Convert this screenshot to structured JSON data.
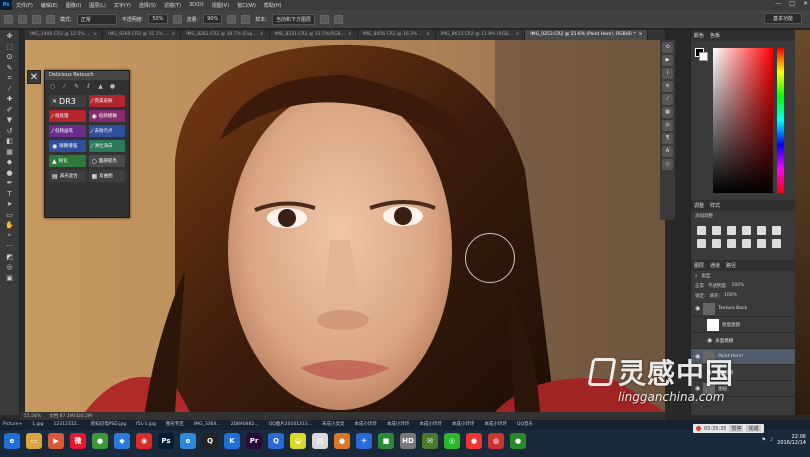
{
  "menubar": {
    "logo": "Ps",
    "items": [
      "文件(F)",
      "编辑(E)",
      "图像(I)",
      "图层(L)",
      "文字(Y)",
      "选择(S)",
      "滤镜(T)",
      "3D(D)",
      "视图(V)",
      "窗口(W)",
      "帮助(H)"
    ],
    "controls": [
      "—",
      "□",
      "✕"
    ]
  },
  "options": {
    "mode_label": "模式:",
    "mode_value": "正常",
    "opacity_label": "不透明度:",
    "opacity_value": "50%",
    "flow_label": "流量:",
    "flow_value": "90%",
    "sample_label": "样本:",
    "sample_value": "当前和下方图层",
    "workspace": "基本功能"
  },
  "tabs": [
    {
      "label": "IMG_1490.CR2 @ 12.5% ..."
    },
    {
      "label": "IMG_8269.CR2 @ 15.1% ..."
    },
    {
      "label": "IMG_8281.CR2 @ 18.7% (Exp..."
    },
    {
      "label": "IMG_8331.CR2 @ 13.5%(RGB..."
    },
    {
      "label": "IMG_8456.CR2 @ 16.3% ..."
    },
    {
      "label": "IMG_8615.CR2 @ 11.8% (RGB..."
    },
    {
      "label": "IMG_0253.CR2 @ 55.6% (Paint Here!, RGB/8) *",
      "active": true
    }
  ],
  "status": {
    "zoom": "55.56%",
    "doc": "文档:87.1M/320.2M"
  },
  "plugin": {
    "title": "Delicious Retouch",
    "buttons": [
      {
        "label": "DR3",
        "color": "#3e3e3e"
      },
      {
        "label": "完美皮肤",
        "color": "#b3262d"
      },
      {
        "label": "批处理",
        "color": "#b3262d"
      },
      {
        "label": "低频模糊",
        "color": "#8a2a6e"
      },
      {
        "label": "低频画笔",
        "color": "#6a2d8a"
      },
      {
        "label": "去除污点",
        "color": "#2e4f9a"
      },
      {
        "label": "眼睛增强",
        "color": "#2e4f9a"
      },
      {
        "label": "清仕净白",
        "color": "#2c7a5c"
      },
      {
        "label": "锐化",
        "color": "#2d7a3a"
      },
      {
        "label": "面部提亮",
        "color": "#4a4a4a"
      },
      {
        "label": "减光混合",
        "color": "#3e3e3e"
      },
      {
        "label": "双曲图",
        "color": "#3e3e3e"
      }
    ]
  },
  "panels": {
    "color_tabs": [
      "颜色",
      "色板"
    ],
    "adj_tabs": [
      "调整",
      "样式"
    ],
    "adj_title": "添加调整",
    "layer_tabs": [
      "图层",
      "通道",
      "路径"
    ],
    "kind": "类型",
    "blend": "正常",
    "opacity_label": "不透明度:",
    "opacity_value": "100%",
    "fill_label": "填充:",
    "fill_value": "100%",
    "lock_label": "锁定:",
    "layers": [
      "Texture Back",
      "智能滤镜",
      "表面模糊",
      "Paint Here!",
      "表面模糊",
      "图层"
    ]
  },
  "taskbar": {
    "windows": [
      "Picture+",
      "1.jpg",
      "12312312...",
      "新知识电PSD.jpg",
      "f5L-1.jpg",
      "图形专区",
      "IMG_3364...",
      "2D8A0882...",
      "QQ图片20161213...",
      "未成小灵灵",
      "本成小玲玲",
      "本成小玲玲",
      "本成小玲玲",
      "本成小玲玲",
      "本成小玲玲",
      "QQ音乐"
    ],
    "app_icons": [
      {
        "name": "ie-icon",
        "g": "e",
        "c": "#1e6fd9"
      },
      {
        "name": "folder-icon",
        "g": "▭",
        "c": "#d9a43a"
      },
      {
        "name": "media-icon",
        "g": "▶",
        "c": "#d9583a"
      },
      {
        "name": "weibo-icon",
        "g": "微",
        "c": "#e6162d"
      },
      {
        "name": "chrome-icon",
        "g": "●",
        "c": "#3a9a3a"
      },
      {
        "name": "app-icon",
        "g": "◆",
        "c": "#2a7ad9"
      },
      {
        "name": "player-icon",
        "g": "◉",
        "c": "#d92a2a"
      },
      {
        "name": "ps-icon",
        "g": "Ps",
        "c": "#001e36"
      },
      {
        "name": "browser-icon",
        "g": "e",
        "c": "#2a8ad9"
      },
      {
        "name": "qq-icon",
        "g": "Q",
        "c": "#222222"
      },
      {
        "name": "k-icon",
        "g": "K",
        "c": "#1e6fd9"
      },
      {
        "name": "pr-icon",
        "g": "Pr",
        "c": "#2a0a3a"
      },
      {
        "name": "qqbrowser-icon",
        "g": "Q",
        "c": "#2a6ad9"
      },
      {
        "name": "bird-icon",
        "g": "◒",
        "c": "#d9d92a"
      },
      {
        "name": "notes-icon",
        "g": "▤",
        "c": "#d9d9d9"
      },
      {
        "name": "firefox-icon",
        "g": "●",
        "c": "#d9772a"
      },
      {
        "name": "maps-icon",
        "g": "✈",
        "c": "#2a6ad9"
      },
      {
        "name": "green-icon",
        "g": "■",
        "c": "#2a8a3a"
      },
      {
        "name": "hd-icon",
        "g": "HD",
        "c": "#7a7a7a"
      },
      {
        "name": "mail-icon",
        "g": "✉",
        "c": "#4a7a2a"
      },
      {
        "name": "wechat-icon",
        "g": "◎",
        "c": "#2ab72a"
      },
      {
        "name": "record-icon",
        "g": "●",
        "c": "#e33"
      },
      {
        "name": "circle-icon",
        "g": "◍",
        "c": "#c33"
      },
      {
        "name": "chrome2-icon",
        "g": "●",
        "c": "#2a8a2a"
      }
    ],
    "time": "22:06",
    "date": "2016/12/14"
  },
  "recorder": {
    "time": "03:35:35",
    "pause": "暂停",
    "stop": "完成"
  },
  "watermark": {
    "cn": "灵感中国",
    "url": "lingganchina.com"
  }
}
